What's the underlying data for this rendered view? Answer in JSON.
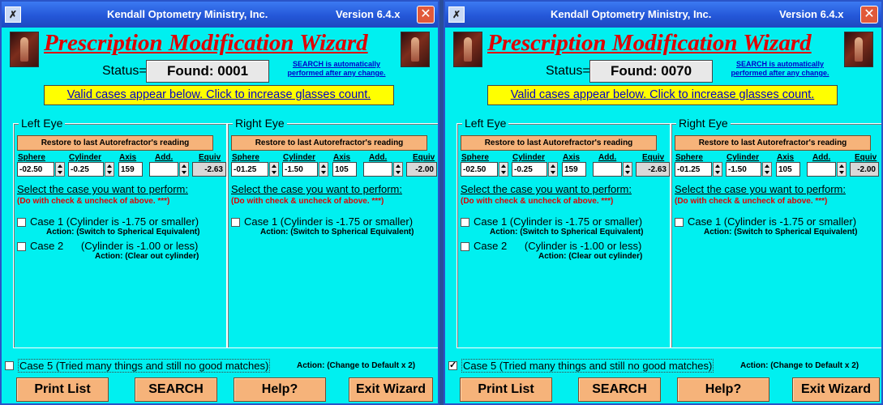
{
  "windows": [
    {
      "title": "Kendall Optometry Ministry, Inc.",
      "version": "Version 6.4.x",
      "wizard_title": "Prescription Modification Wizard",
      "status_label": "Status=",
      "status_value": "Found:  0001",
      "search_note": "SEARCH is automatically performed after any change.",
      "banner": "Valid cases appear below.  Click to increase glasses count.",
      "left_eye": {
        "legend": "Left Eye",
        "restore": "Restore to last Autorefractor's reading",
        "labels": {
          "sphere": "Sphere",
          "cylinder": "Cylinder",
          "axis": "Axis",
          "add": "Add.",
          "equiv": "Equiv"
        },
        "sphere": "-02.50",
        "cylinder": "-0.25",
        "axis": "159",
        "add": "",
        "equiv": "-2.63",
        "select_heading": "Select the case you want to perform:",
        "do_note": "(Do with check & uncheck of above. ***)",
        "cases": [
          {
            "label": "Case 1  (Cylinder is -1.75 or smaller)",
            "action": "Action:  (Switch to Spherical Equivalent)",
            "checked": false
          },
          {
            "label": "Case 2      (Cylinder is -1.00 or less)",
            "action": "Action:  (Clear out cylinder)",
            "checked": false
          }
        ]
      },
      "right_eye": {
        "legend": "Right Eye",
        "restore": "Restore to last Autorefractor's reading",
        "labels": {
          "sphere": "Sphere",
          "cylinder": "Cylinder",
          "axis": "Axis",
          "add": "Add.",
          "equiv": "Equiv"
        },
        "sphere": "-01.25",
        "cylinder": "-1.50",
        "axis": "105",
        "add": "",
        "equiv": "-2.00",
        "select_heading": "Select the case you want to perform:",
        "do_note": "(Do with check & uncheck of above. ***)",
        "cases": [
          {
            "label": "Case 1  (Cylinder is -1.75 or smaller)",
            "action": "Action:  (Switch to Spherical Equivalent)",
            "checked": false
          }
        ]
      },
      "case5": {
        "label": "Case 5 (Tried many things and still no good matches)",
        "action": "Action:  (Change to Default x 2)",
        "checked": false
      },
      "buttons": {
        "print": "Print List",
        "search": "SEARCH",
        "help": "Help?",
        "exit": "Exit Wizard"
      }
    },
    {
      "title": "Kendall Optometry Ministry, Inc.",
      "version": "Version 6.4.x",
      "wizard_title": "Prescription Modification Wizard",
      "status_label": "Status=",
      "status_value": "Found:  0070",
      "search_note": "SEARCH is automatically performed after any change.",
      "banner": "Valid cases appear below.  Click to increase glasses count.",
      "left_eye": {
        "legend": "Left Eye",
        "restore": "Restore to last Autorefractor's reading",
        "labels": {
          "sphere": "Sphere",
          "cylinder": "Cylinder",
          "axis": "Axis",
          "add": "Add.",
          "equiv": "Equiv"
        },
        "sphere": "-02.50",
        "cylinder": "-0.25",
        "axis": "159",
        "add": "",
        "equiv": "-2.63",
        "select_heading": "Select the case you want to perform:",
        "do_note": "(Do with check & uncheck of above. ***)",
        "cases": [
          {
            "label": "Case 1  (Cylinder is -1.75 or smaller)",
            "action": "Action:  (Switch to Spherical Equivalent)",
            "checked": false
          },
          {
            "label": "Case 2      (Cylinder is -1.00 or less)",
            "action": "Action:  (Clear out cylinder)",
            "checked": false
          }
        ]
      },
      "right_eye": {
        "legend": "Right Eye",
        "restore": "Restore to last Autorefractor's reading",
        "labels": {
          "sphere": "Sphere",
          "cylinder": "Cylinder",
          "axis": "Axis",
          "add": "Add.",
          "equiv": "Equiv"
        },
        "sphere": "-01.25",
        "cylinder": "-1.50",
        "axis": "105",
        "add": "",
        "equiv": "-2.00",
        "select_heading": "Select the case you want to perform:",
        "do_note": "(Do with check & uncheck of above. ***)",
        "cases": [
          {
            "label": "Case 1  (Cylinder is -1.75 or smaller)",
            "action": "Action:  (Switch to Spherical Equivalent)",
            "checked": false
          }
        ]
      },
      "case5": {
        "label": "Case 5 (Tried many things and still no good matches)",
        "action": "Action:  (Change to Default x 2)",
        "checked": true
      },
      "buttons": {
        "print": "Print List",
        "search": "SEARCH",
        "help": "Help?",
        "exit": "Exit Wizard"
      }
    }
  ]
}
